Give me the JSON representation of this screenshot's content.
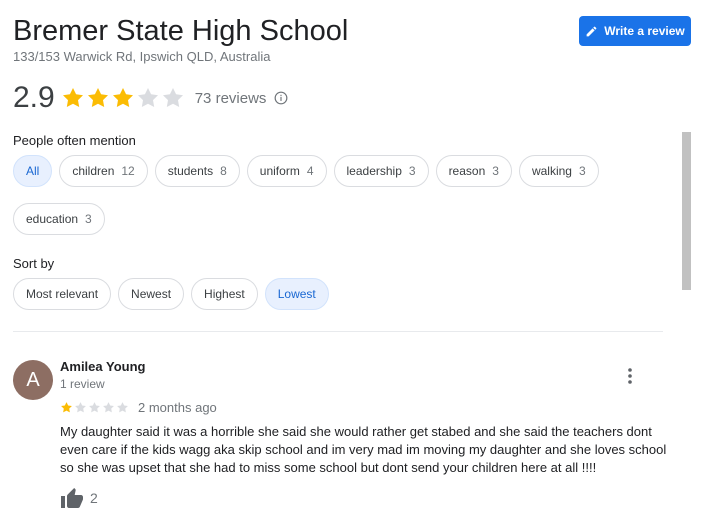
{
  "place": {
    "name": "Bremer State High School",
    "address": "133/153 Warwick Rd, Ipswich QLD, Australia",
    "rating": "2.9",
    "rating_stars": 2.9,
    "review_count": "73 reviews"
  },
  "actions": {
    "write_review": "Write a review"
  },
  "mentions": {
    "label": "People often mention",
    "items": [
      {
        "label": "All",
        "count": "",
        "active": true
      },
      {
        "label": "children",
        "count": "12"
      },
      {
        "label": "students",
        "count": "8"
      },
      {
        "label": "uniform",
        "count": "4"
      },
      {
        "label": "leadership",
        "count": "3"
      },
      {
        "label": "reason",
        "count": "3"
      },
      {
        "label": "walking",
        "count": "3"
      },
      {
        "label": "education",
        "count": "3"
      }
    ]
  },
  "sort": {
    "label": "Sort by",
    "options": [
      "Most relevant",
      "Newest",
      "Highest",
      "Lowest"
    ],
    "selected": "Lowest"
  },
  "review": {
    "avatar_letter": "A",
    "author": "Amilea Young",
    "author_meta": "1 review",
    "rating": 1,
    "date": "2 months ago",
    "text": "My daughter said it was a horrible she said she would rather get stabed and she said the teachers dont even care if the kids wagg aka skip school and im very mad im moving my daughter and she loves school so she was upset that she had to miss some school but dont send your children here at all !!!!",
    "likes": "2"
  },
  "colors": {
    "accent": "#1a73e8",
    "star_filled": "#fbbc04",
    "star_empty": "#dadce0",
    "chip_active_bg": "#e8f0fe",
    "avatar_bg": "#8d6e63"
  }
}
